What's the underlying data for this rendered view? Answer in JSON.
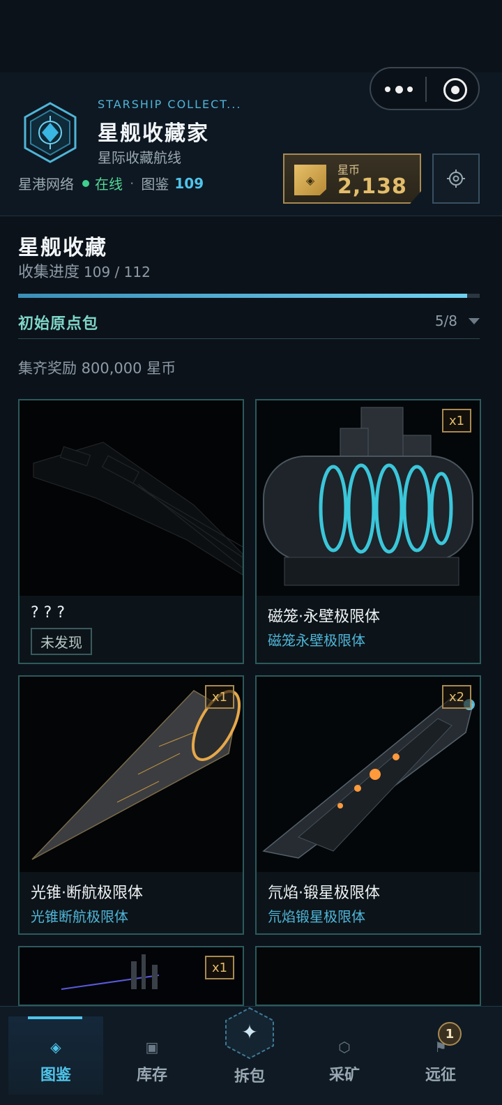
{
  "header": {
    "subtitle_en": "STARSHIP COLLECT...",
    "title": "星舰收藏家",
    "subtitle": "星际收藏航线",
    "network_label": "星港网络",
    "network_status": "在线",
    "separator": "·",
    "codex_label": "图鉴",
    "codex_count": "109",
    "coin_label": "星币",
    "coin_value": "2,138",
    "coin_chip_icon": "diamond-icon",
    "settings_icon": "gear-icon",
    "capsule_more_icon": "more-icon",
    "capsule_close_icon": "target-icon"
  },
  "collection": {
    "title": "星舰收藏",
    "progress_label": "收集进度",
    "progress_value": "109 / 112",
    "progress_fraction": 0.973,
    "pack_name": "初始原点包",
    "pack_count": "5/8",
    "reward_text": "集齐奖励 800,000 星币"
  },
  "cards": [
    {
      "name": "? ? ?",
      "tag": "未发现",
      "qty": ""
    },
    {
      "name": "磁笼·永壁极限体",
      "sub": "磁笼永壁极限体",
      "qty": "x1"
    },
    {
      "name": "光锥·断航极限体",
      "sub": "光锥断航极限体",
      "qty": "x1"
    },
    {
      "name": "氘焰·锻星极限体",
      "sub": "氘焰锻星极限体",
      "qty": "x2"
    },
    {
      "qty": "x1"
    },
    {
      "qty": ""
    }
  ],
  "nav": {
    "items": [
      {
        "label": "图鉴",
        "icon": "codex-icon",
        "glyph": "◈"
      },
      {
        "label": "库存",
        "icon": "inventory-icon",
        "glyph": "▣"
      },
      {
        "label": "拆包",
        "icon": "star-icon",
        "glyph": "✦"
      },
      {
        "label": "采矿",
        "icon": "hexagon-icon",
        "glyph": "⬡"
      },
      {
        "label": "远征",
        "icon": "flag-icon",
        "glyph": "⚑"
      }
    ],
    "badge": "1"
  },
  "colors": {
    "accent": "#4fc4ea",
    "gold": "#e3bd6b",
    "teal": "#7fd6c8",
    "online": "#52d897"
  }
}
